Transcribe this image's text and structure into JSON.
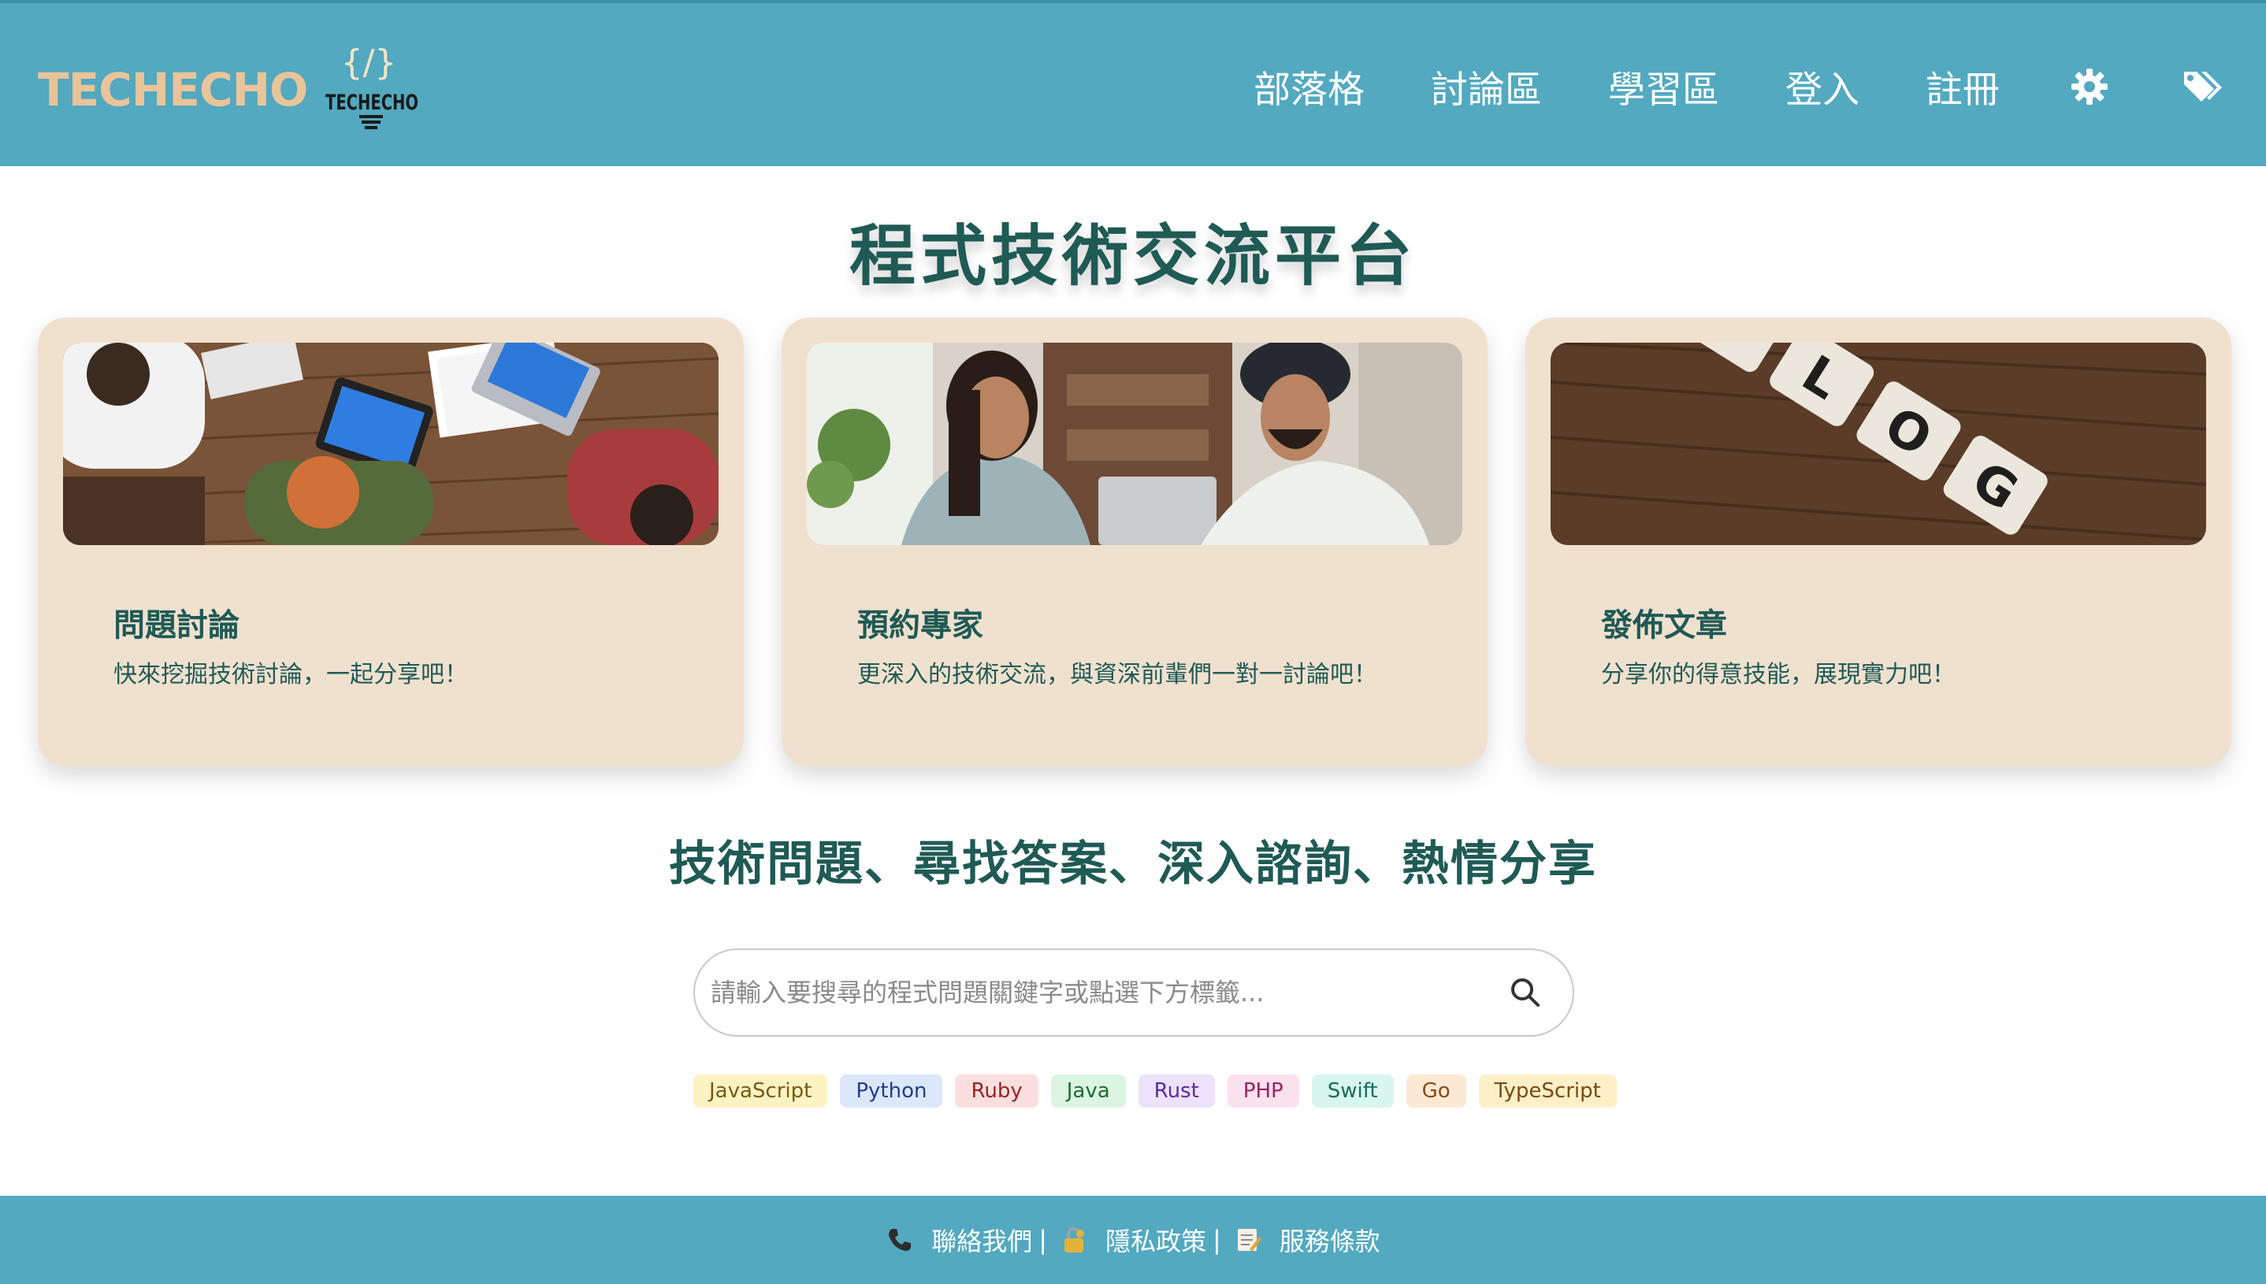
{
  "header": {
    "logo_text": "TECHECHO",
    "logo_mark_text": "TECHECHO",
    "logo_mark_glyph": "{/}",
    "nav": [
      "部落格",
      "討論區",
      "學習區",
      "登入",
      "註冊"
    ],
    "icons": [
      "gear-icon",
      "tags-icon"
    ]
  },
  "hero": {
    "title": "程式技術交流平台"
  },
  "cards": [
    {
      "title": "問題討論",
      "desc": "快來挖掘技術討論，一起分享吧！",
      "image": "team-meeting-photo"
    },
    {
      "title": "預約專家",
      "desc": "更深入的技術交流，與資深前輩們一對一討論吧！",
      "image": "consultation-photo"
    },
    {
      "title": "發佈文章",
      "desc": "分享你的得意技能，展現實力吧！",
      "image": "blog-tiles-photo"
    }
  ],
  "subtitle": "技術問題、尋找答案、深入諮詢、熱情分享",
  "search": {
    "placeholder": "請輸入要搜尋的程式問題關鍵字或點選下方標籤...",
    "value": ""
  },
  "tags": [
    {
      "label": "JavaScript",
      "bg": "#fdf3c2",
      "fg": "#7a5a12"
    },
    {
      "label": "Python",
      "bg": "#dce7fb",
      "fg": "#1f3f8a"
    },
    {
      "label": "Ruby",
      "bg": "#fbdede",
      "fg": "#9a2525"
    },
    {
      "label": "Java",
      "bg": "#dcf5e2",
      "fg": "#1e6b35"
    },
    {
      "label": "Rust",
      "bg": "#ece2fb",
      "fg": "#5a2c9c"
    },
    {
      "label": "PHP",
      "bg": "#fbe1ee",
      "fg": "#9a2360"
    },
    {
      "label": "Swift",
      "bg": "#d8f5ee",
      "fg": "#1a6b5c"
    },
    {
      "label": "Go",
      "bg": "#fbe9d4",
      "fg": "#8a4a12"
    },
    {
      "label": "TypeScript",
      "bg": "#fdefc8",
      "fg": "#7a4a12"
    }
  ],
  "footer": {
    "contact": "聯絡我們",
    "privacy": "隱私政策",
    "terms": "服務條款",
    "separator": "|"
  },
  "colors": {
    "primary": "#52a9c0",
    "heading": "#1f5a55",
    "card_bg": "#f0e1cf",
    "logo": "#e9c49a"
  }
}
